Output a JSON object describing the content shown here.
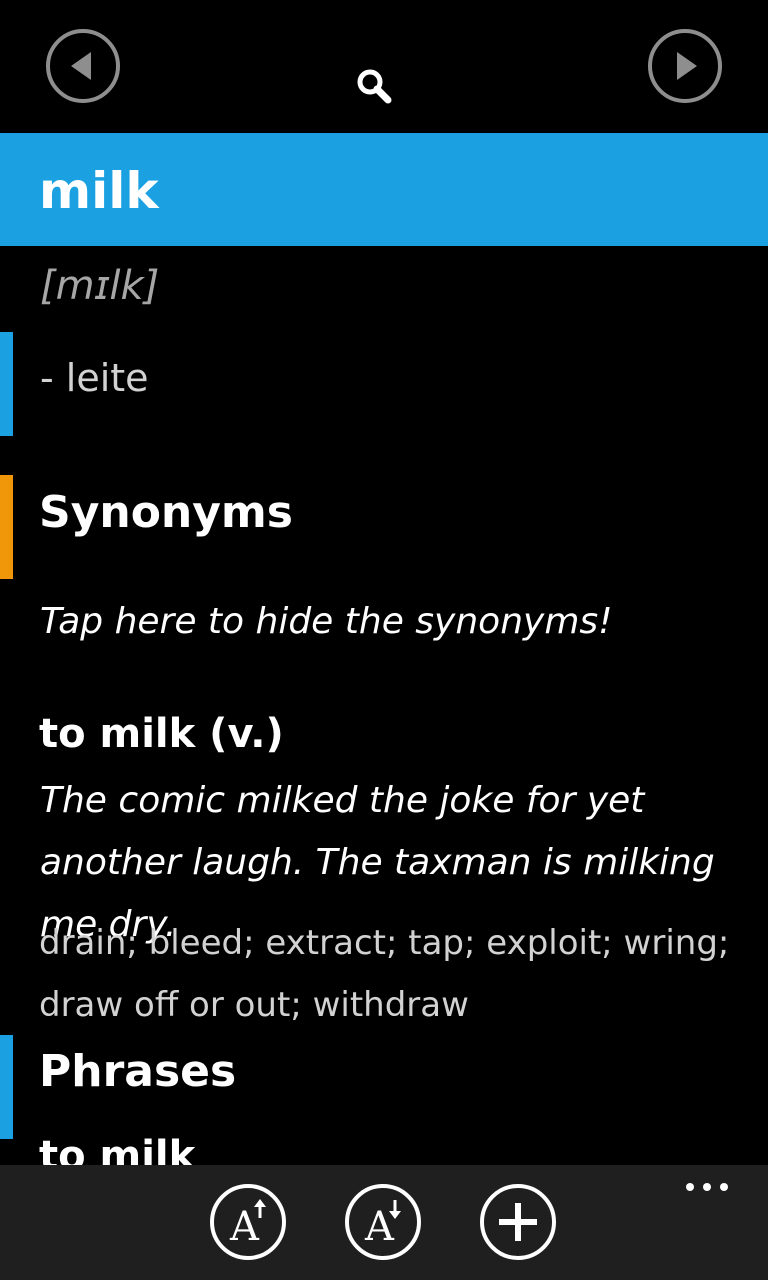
{
  "header": {
    "back_icon": "back-arrow-icon",
    "search_icon": "search-icon",
    "forward_icon": "forward-arrow-icon"
  },
  "entry": {
    "word": "milk",
    "pronunciation": "[mɪlk]",
    "translation": "- leite"
  },
  "synonyms": {
    "heading": "Synonyms",
    "hint": "Tap here to hide the synonyms!",
    "word": "to milk (v.)",
    "example": "The comic milked the joke for yet another laugh. The taxman is milking me dry.",
    "list": "drain; bleed; extract; tap; exploit; wring; draw off or out; withdraw"
  },
  "phrases": {
    "heading": "Phrases",
    "first_item": "to milk"
  },
  "appbar": {
    "increase_font_icon": "font-size-increase-icon",
    "decrease_font_icon": "font-size-decrease-icon",
    "add_icon": "add-icon",
    "more_icon": "more-ellipsis-icon"
  },
  "colors": {
    "accent_blue": "#1ba1e2",
    "accent_orange": "#f09609",
    "background": "#000000",
    "appbar": "#1f1f1f"
  }
}
